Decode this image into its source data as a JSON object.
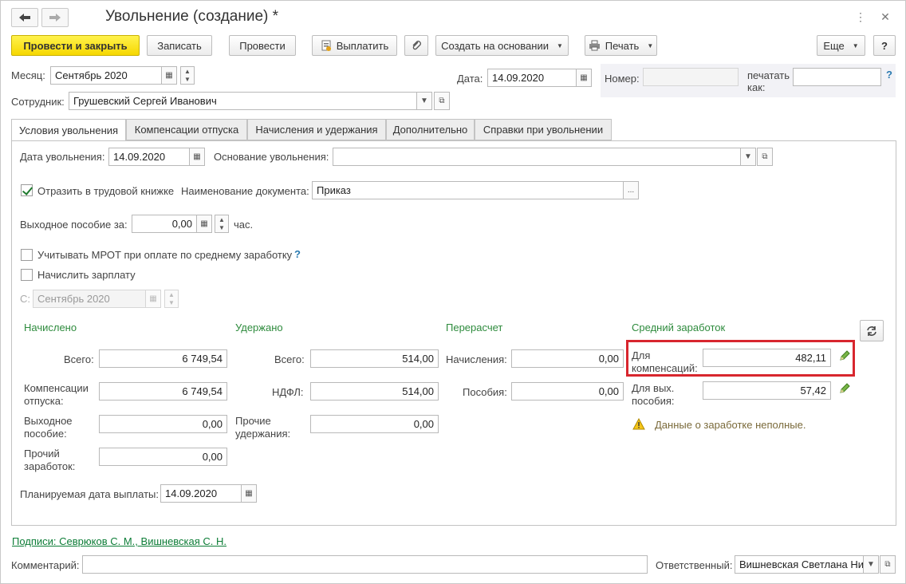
{
  "window": {
    "title": "Увольнение (создание) *"
  },
  "toolbar": {
    "post_close": "Провести и закрыть",
    "save": "Записать",
    "post": "Провести",
    "pay": "Выплатить",
    "create_based": "Создать на основании",
    "print": "Печать",
    "more": "Еще",
    "help": "?"
  },
  "header": {
    "month_label": "Месяц:",
    "month_value": "Сентябрь 2020",
    "date_label": "Дата:",
    "date_value": "14.09.2020",
    "number_label": "Номер:",
    "number_value": "",
    "print_as_label": "печатать как:",
    "print_as_value": "",
    "employee_label": "Сотрудник:",
    "employee_value": "Грушевский Сергей Иванович"
  },
  "tabs": [
    {
      "label": "Условия увольнения",
      "active": true
    },
    {
      "label": "Компенсации отпуска",
      "active": false
    },
    {
      "label": "Начисления и удержания",
      "active": false
    },
    {
      "label": "Дополнительно",
      "active": false
    },
    {
      "label": "Справки при увольнении",
      "active": false
    }
  ],
  "conditions": {
    "dismissal_date_label": "Дата увольнения:",
    "dismissal_date_value": "14.09.2020",
    "basis_label": "Основание увольнения:",
    "basis_value": "",
    "workbook_label": "Отразить в трудовой книжке",
    "workbook_checked": true,
    "doc_name_label": "Наименование документа:",
    "doc_name_value": "Приказ",
    "severance_label": "Выходное пособие за:",
    "severance_value": "0,00",
    "severance_unit": "час.",
    "mrot_label": "Учитывать МРОТ при оплате по среднему заработку",
    "mrot_help": "?",
    "mrot_checked": false,
    "accrue_salary_label": "Начислить зарплату",
    "accrue_salary_checked": false,
    "from_label": "С:",
    "from_value": "Сентябрь 2020"
  },
  "accrued": {
    "heading": "Начислено",
    "total_label": "Всего:",
    "total_value": "6 749,54",
    "vacation_comp_label_1": "Компенсации",
    "vacation_comp_label_2": "отпуска:",
    "vacation_comp_value": "6 749,54",
    "severance_label_1": "Выходное",
    "severance_label_2": "пособие:",
    "severance_value": "0,00",
    "other_label_1": "Прочий",
    "other_label_2": "заработок:",
    "other_value": "0,00"
  },
  "withheld": {
    "heading": "Удержано",
    "total_label": "Всего:",
    "total_value": "514,00",
    "ndfl_label": "НДФЛ:",
    "ndfl_value": "514,00",
    "other_label_1": "Прочие",
    "other_label_2": "удержания:",
    "other_value": "0,00"
  },
  "recalc": {
    "heading": "Перерасчет",
    "accruals_label": "Начисления:",
    "accruals_value": "0,00",
    "benefits_label": "Пособия:",
    "benefits_value": "0,00"
  },
  "average": {
    "heading": "Средний заработок",
    "comp_label_1": "Для",
    "comp_label_2": "компенсаций:",
    "comp_value": "482,11",
    "sev_label_1": "Для вых.",
    "sev_label_2": "пособия:",
    "sev_value": "57,42",
    "warning": "Данные о заработке неполные."
  },
  "payment": {
    "planned_date_label": "Планируемая дата выплаты:",
    "planned_date_value": "14.09.2020"
  },
  "footer": {
    "signatures": "Подписи: Севрюков С. М., Вишневская С. Н.",
    "comment_label": "Комментарий:",
    "comment_value": "",
    "responsible_label": "Ответственный:",
    "responsible_value": "Вишневская Светлана Ни"
  },
  "colors": {
    "primary_button": "#f6d700",
    "green_heading": "#2e8b3d",
    "highlight_box": "#d8262e"
  }
}
